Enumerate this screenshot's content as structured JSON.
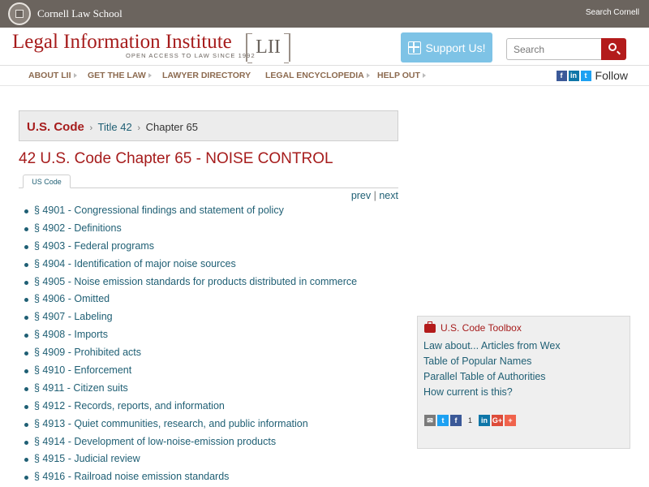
{
  "cornell_bar": {
    "school_name": "Cornell Law School",
    "search_link": "Search Cornell"
  },
  "header": {
    "title": "Legal Information Institute",
    "tagline": "OPEN ACCESS TO LAW SINCE 1992",
    "logo_text": "LII",
    "support_label": "Support Us!",
    "search_placeholder": "Search"
  },
  "nav": {
    "items": [
      {
        "label": "ABOUT LII"
      },
      {
        "label": "GET THE LAW"
      },
      {
        "label": "LAWYER DIRECTORY"
      },
      {
        "label": "LEGAL ENCYCLOPEDIA"
      },
      {
        "label": "HELP OUT"
      }
    ],
    "follow_label": "Follow"
  },
  "breadcrumb": {
    "root": "U.S. Code",
    "title": "Title 42",
    "chapter": "Chapter 65",
    "separator": "›"
  },
  "page": {
    "title": "42 U.S. Code Chapter 65 - NOISE CONTROL",
    "tab_label": "US Code",
    "prev_label": "prev",
    "next_label": "next",
    "pager_separator": "|"
  },
  "sections": [
    "§ 4901 - Congressional findings and statement of policy",
    "§ 4902 - Definitions",
    "§ 4903 - Federal programs",
    "§ 4904 - Identification of major noise sources",
    "§ 4905 - Noise emission standards for products distributed in commerce",
    "§ 4906 - Omitted",
    "§ 4907 - Labeling",
    "§ 4908 - Imports",
    "§ 4909 - Prohibited acts",
    "§ 4910 - Enforcement",
    "§ 4911 - Citizen suits",
    "§ 4912 - Records, reports, and information",
    "§ 4913 - Quiet communities, research, and public information",
    "§ 4914 - Development of low-noise-emission products",
    "§ 4915 - Judicial review",
    "§ 4916 - Railroad noise emission standards"
  ],
  "toolbox": {
    "title": "U.S. Code Toolbox",
    "links": [
      "Law about... Articles from Wex",
      "Table of Popular Names",
      "Parallel Table of Authorities",
      "How current is this?"
    ],
    "share_count": "1"
  },
  "icons": {
    "facebook": "f",
    "linkedin": "in",
    "twitter": "t",
    "googleplus": "G+",
    "add": "+"
  },
  "colors": {
    "brand_red": "#a61c1c",
    "link_teal": "#1f5f74",
    "cornell_bar": "#6b645e",
    "support_blue": "#7ec3e6"
  }
}
